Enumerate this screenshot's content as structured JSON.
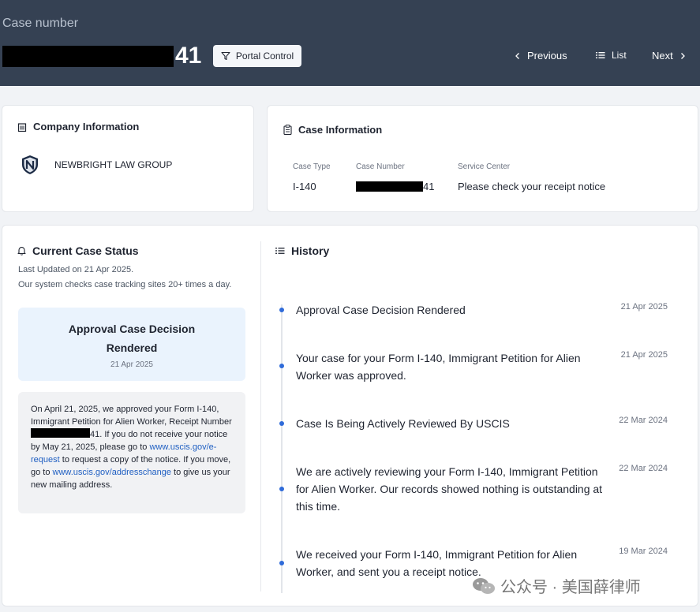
{
  "header": {
    "case_label": "Case number",
    "case_suffix": "41",
    "portal_button": "Portal Control",
    "nav": {
      "previous": "Previous",
      "list": "List",
      "next": "Next"
    }
  },
  "company": {
    "title": "Company Information",
    "name": "NEWBRIGHT LAW GROUP"
  },
  "case_info": {
    "title": "Case Information",
    "columns": [
      {
        "label": "Case Type",
        "value": "I-140"
      },
      {
        "label": "Case Number",
        "value": "41"
      },
      {
        "label": "Service Center",
        "value": "Please check your receipt notice"
      }
    ]
  },
  "status": {
    "title": "Current Case Status",
    "last_updated": "Last Updated on 21 Apr 2025.",
    "check_note": "Our system checks case tracking sites 20+ times a day.",
    "box_title": "Approval Case Decision Rendered",
    "box_date": "21 Apr 2025",
    "notice": {
      "p1": "On April 21, 2025, we approved your Form I-140, Immigrant Petition for Alien Worker, Receipt Number ",
      "receipt_suffix": "41",
      "p2": ". If you do not receive your notice by May 21, 2025, please go to ",
      "link1": "www.uscis.gov/e-request",
      "p3": " to request a copy of the notice. If you move, go to ",
      "link2": "www.uscis.gov/addresschange",
      "p4": " to give us your new mailing address."
    }
  },
  "history": {
    "title": "History",
    "items": [
      {
        "text": "Approval Case Decision Rendered",
        "date": "21 Apr 2025"
      },
      {
        "text": "Your case for your Form I-140, Immigrant Petition for Alien Worker was approved.",
        "date": "21 Apr 2025"
      },
      {
        "text": "Case Is Being Actively Reviewed By USCIS",
        "date": "22 Mar 2024"
      },
      {
        "text": "We are actively reviewing your Form I-140, Immigrant Petition for Alien Worker. Our records showed nothing is outstanding at this time.",
        "date": "22 Mar 2024"
      },
      {
        "text": "We received your Form I-140, Immigrant Petition for Alien Worker, and sent you a receipt notice.",
        "date": "19 Mar 2024"
      }
    ]
  },
  "watermark": {
    "text": "公众号 · 美国薛律师"
  },
  "colors": {
    "header_bg": "#354153",
    "accent": "#2f6bd9",
    "link": "#1f5fc2",
    "status_box_bg": "#eaf3fd"
  }
}
